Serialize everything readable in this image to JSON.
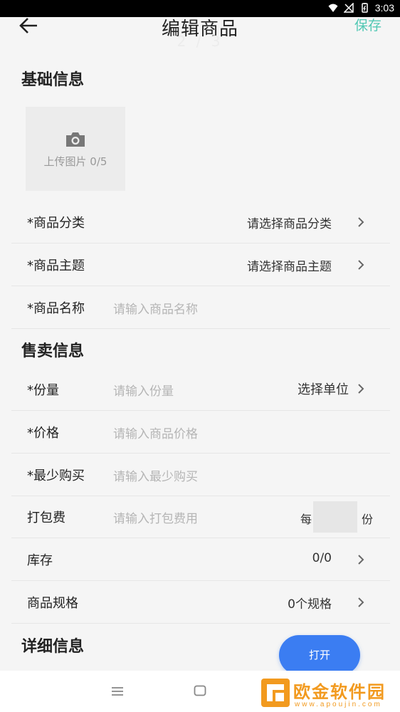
{
  "status_bar": {
    "time": "3:03"
  },
  "header": {
    "title": "编辑商品",
    "page_indicator": "2 / 3",
    "save_label": "保存"
  },
  "sections": {
    "basic": "基础信息",
    "sales": "售卖信息",
    "detail": "详细信息"
  },
  "upload": {
    "label": "上传图片 0/5"
  },
  "basic_rows": {
    "category": {
      "label": "*商品分类",
      "value": "请选择商品分类"
    },
    "theme": {
      "label": "*商品主题",
      "value": "请选择商品主题"
    },
    "name": {
      "label": "*商品名称",
      "placeholder": "请输入商品名称"
    }
  },
  "sales_rows": {
    "portion": {
      "label": "*份量",
      "placeholder": "请输入份量",
      "unit": "选择单位"
    },
    "price": {
      "label": "*价格",
      "placeholder": "请输入商品价格"
    },
    "min_buy": {
      "label": "*最少购买",
      "placeholder": "请输入最少购买"
    },
    "packing": {
      "label": "打包费",
      "placeholder": "请输入打包费用",
      "per": "每",
      "unit": "份"
    },
    "stock": {
      "label": "库存",
      "value": "0/0"
    },
    "spec": {
      "label": "商品规格",
      "value": "0个规格"
    }
  },
  "floating_button": {
    "label": "打开"
  },
  "watermark": {
    "text": "欧金软件园",
    "url": "www.apoujin.com"
  },
  "colors": {
    "accent": "#52c8b4",
    "primary_button": "#3b7df2",
    "watermark": "#f29a1f",
    "background": "#f5f5f5"
  },
  "icons": {
    "status": [
      "wifi-icon",
      "no-signal-icon",
      "battery-icon"
    ],
    "back": "arrow-left-icon",
    "camera": "camera-icon",
    "chevron": "chevron-right-icon",
    "nav": [
      "menu-icon",
      "home-icon"
    ],
    "logo": "watermark-logo-icon"
  }
}
